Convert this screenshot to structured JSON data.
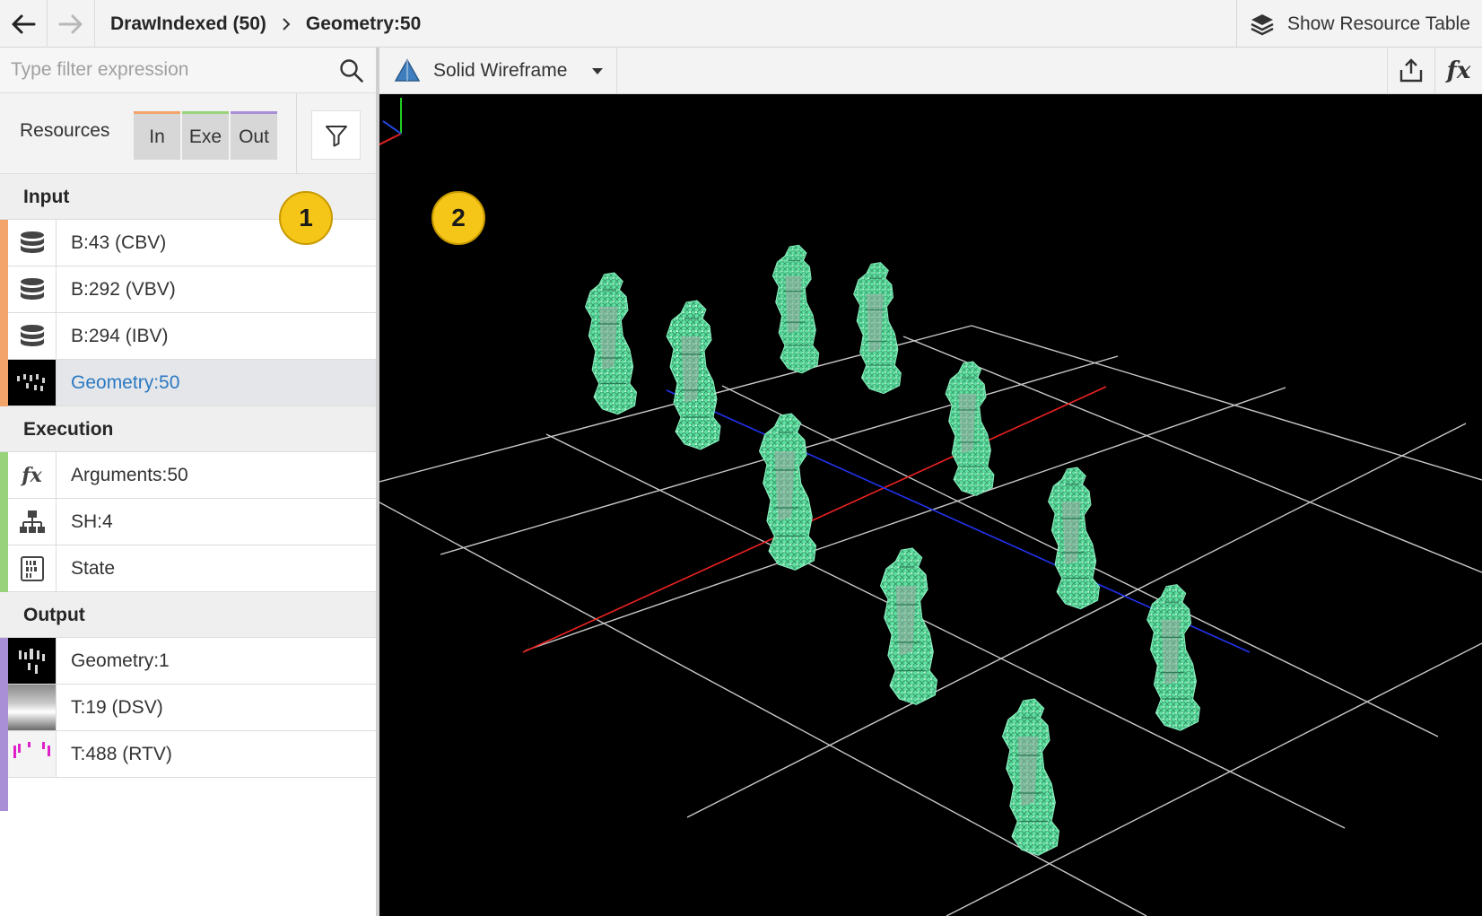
{
  "topbar": {
    "breadcrumb": [
      "DrawIndexed (50)",
      "Geometry:50"
    ],
    "show_resource_table_label": "Show Resource Table"
  },
  "filter": {
    "placeholder": "Type filter expression"
  },
  "resources": {
    "label": "Resources",
    "segments": [
      "In",
      "Exe",
      "Out"
    ]
  },
  "sections": {
    "input": {
      "title": "Input",
      "items": [
        {
          "label": "B:43 (CBV)",
          "icon": "database-icon"
        },
        {
          "label": "B:292 (VBV)",
          "icon": "database-icon"
        },
        {
          "label": "B:294 (IBV)",
          "icon": "database-icon"
        },
        {
          "label": "Geometry:50",
          "icon": "geometry-thumbnail",
          "selected": true
        }
      ]
    },
    "execution": {
      "title": "Execution",
      "items": [
        {
          "label": "Arguments:50",
          "icon": "fx-icon"
        },
        {
          "label": "SH:4",
          "icon": "shader-hierarchy-icon"
        },
        {
          "label": "State",
          "icon": "binary-state-icon"
        }
      ]
    },
    "output": {
      "title": "Output",
      "items": [
        {
          "label": "Geometry:1",
          "icon": "geometry-thumbnail"
        },
        {
          "label": "T:19 (DSV)",
          "icon": "depth-thumbnail"
        },
        {
          "label": "T:488 (RTV)",
          "icon": "rendertarget-thumbnail"
        }
      ]
    }
  },
  "viewport": {
    "mode_label": "Solid Wireframe",
    "fx_label": "fx"
  },
  "badges": [
    "1",
    "2"
  ],
  "colors": {
    "input_stripe": "#f2a46b",
    "execution_stripe": "#98d37c",
    "output_stripe": "#a98fd6",
    "mesh": "#5fe0a0",
    "selected_text": "#2b79c2"
  }
}
